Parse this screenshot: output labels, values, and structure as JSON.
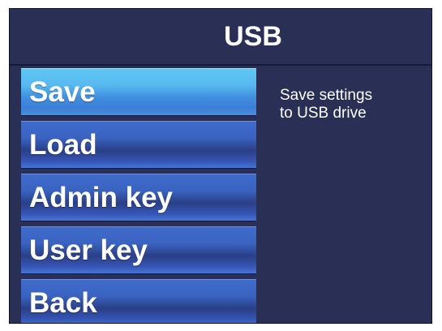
{
  "header": {
    "title": "USB"
  },
  "menu": {
    "items": [
      {
        "label": "Save",
        "selected": true
      },
      {
        "label": "Load",
        "selected": false
      },
      {
        "label": "Admin key",
        "selected": false
      },
      {
        "label": "User key",
        "selected": false
      },
      {
        "label": "Back",
        "selected": false
      }
    ]
  },
  "description": {
    "text": "Save settings\nto USB drive"
  },
  "colors": {
    "background": "#2a2f55",
    "selected_item": "#58b9ef",
    "item": "#3a63c0",
    "text": "#ffffff"
  }
}
